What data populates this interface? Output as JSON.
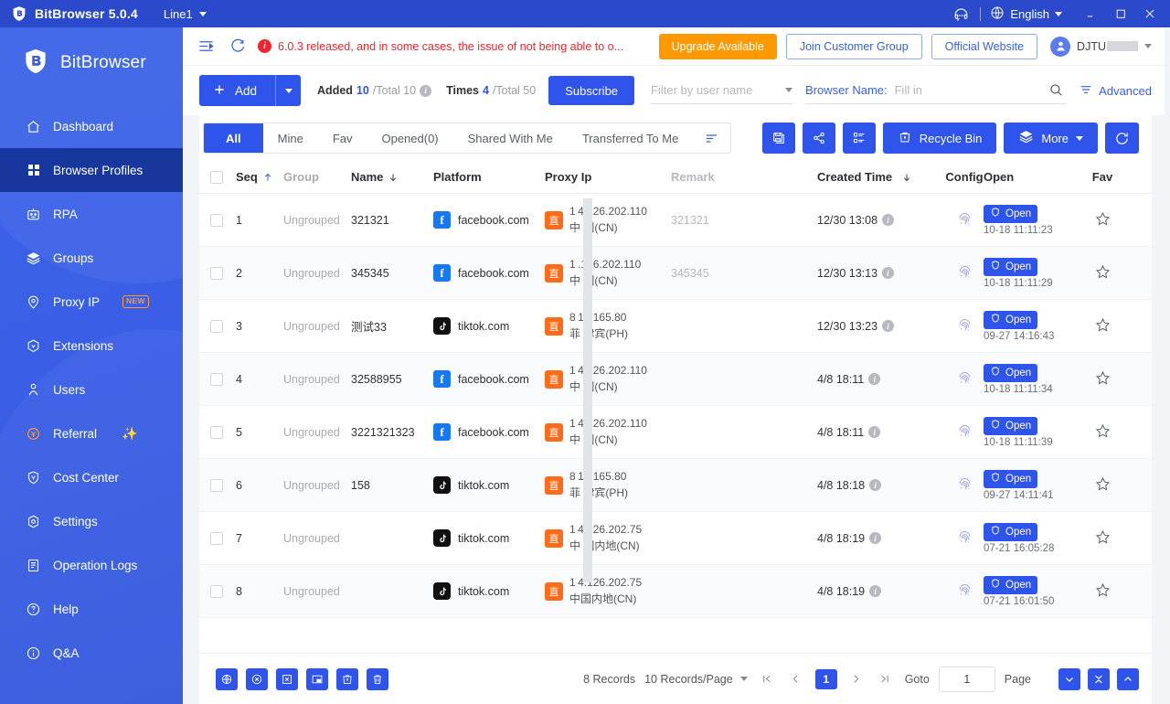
{
  "titlebar": {
    "app_name": "BitBrowser 5.0.4",
    "line_label": "Line1",
    "language": "English",
    "icons": {
      "headset": "headset-icon",
      "globe": "globe-icon",
      "minimize": "minimize-icon",
      "maximize": "maximize-icon",
      "close": "close-icon"
    }
  },
  "topbar": {
    "notice": "6.0.3 released, and in some cases, the issue of not being able to o...",
    "upgrade_label": "Upgrade Available",
    "join_group_label": "Join Customer Group",
    "official_site_label": "Official Website",
    "user_name": "DJTU"
  },
  "actionbar": {
    "add_label": "Add",
    "added_label": "Added",
    "added_value": "10",
    "added_total": "/Total 10",
    "times_label": "Times",
    "times_value": "4",
    "times_total": "/Total 50",
    "subscribe_label": "Subscribe",
    "user_filter_placeholder": "Filter by user name",
    "browser_name_label": "Browser Name:",
    "browser_name_placeholder": "Fill in",
    "advanced_label": "Advanced"
  },
  "tabs": [
    {
      "label": "All",
      "active": true
    },
    {
      "label": "Mine",
      "active": false
    },
    {
      "label": "Fav",
      "active": false
    },
    {
      "label": "Opened(0)",
      "active": false
    },
    {
      "label": "Shared With Me",
      "active": false
    },
    {
      "label": "Transferred To Me",
      "active": false
    }
  ],
  "tools": {
    "recycle_bin_label": "Recycle Bin",
    "more_label": "More",
    "icons": [
      "save-icon",
      "share-icon",
      "list-settings-icon",
      "recycle-bin-icon",
      "layers-icon",
      "refresh-icon"
    ]
  },
  "table": {
    "columns": [
      "Seq",
      "Group",
      "Name",
      "Platform",
      "Proxy Ip",
      "Remark",
      "Created Time",
      "Config",
      "Open",
      "Fav"
    ],
    "rows": [
      {
        "seq": "1",
        "group": "Ungrouped",
        "name": "321321",
        "platform": "facebook.com",
        "platform_icon": "facebook-icon",
        "proxy_ip": "1 4.126.202.110",
        "proxy_loc": "中 国(CN)",
        "remark": "321321",
        "created": "12/30 13:08",
        "open_label": "Open",
        "open_time": "10-18 11:11:23"
      },
      {
        "seq": "2",
        "group": "Ungrouped",
        "name": "345345",
        "platform": "facebook.com",
        "platform_icon": "facebook-icon",
        "proxy_ip": "1 .126.202.110",
        "proxy_loc": "中 国(CN)",
        "remark": "345345",
        "created": "12/30 13:13",
        "open_label": "Open",
        "open_time": "10-18 11:11:29"
      },
      {
        "seq": "3",
        "group": "Ungrouped",
        "name": "测试33",
        "platform": "tiktok.com",
        "platform_icon": "tiktok-icon",
        "proxy_ip": "8 12.165.80",
        "proxy_loc": "菲 律宾(PH)",
        "remark": "",
        "created": "12/30 13:23",
        "open_label": "Open",
        "open_time": "09-27 14:16:43"
      },
      {
        "seq": "4",
        "group": "Ungrouped",
        "name": "32588955",
        "platform": "facebook.com",
        "platform_icon": "facebook-icon",
        "proxy_ip": "1 4.126.202.110",
        "proxy_loc": "中 国(CN)",
        "remark": "",
        "created": "4/8 18:11",
        "open_label": "Open",
        "open_time": "10-18 11:11:34"
      },
      {
        "seq": "5",
        "group": "Ungrouped",
        "name": "3221321323",
        "platform": "facebook.com",
        "platform_icon": "facebook-icon",
        "proxy_ip": "1 4.126.202.110",
        "proxy_loc": "中 国(CN)",
        "remark": "",
        "created": "4/8 18:11",
        "open_label": "Open",
        "open_time": "10-18 11:11:39"
      },
      {
        "seq": "6",
        "group": "Ungrouped",
        "name": "158",
        "platform": "tiktok.com",
        "platform_icon": "tiktok-icon",
        "proxy_ip": "8 12.165.80",
        "proxy_loc": "菲 律宾(PH)",
        "remark": "",
        "created": "4/8 18:18",
        "open_label": "Open",
        "open_time": "09-27 14:11:41"
      },
      {
        "seq": "7",
        "group": "Ungrouped",
        "name": "",
        "platform": "tiktok.com",
        "platform_icon": "tiktok-icon",
        "proxy_ip": "1 4.126.202.75",
        "proxy_loc": "中 国内地(CN)",
        "remark": "",
        "created": "4/8 18:19",
        "open_label": "Open",
        "open_time": "07-21 16:05:28"
      },
      {
        "seq": "8",
        "group": "Ungrouped",
        "name": "",
        "platform": "tiktok.com",
        "platform_icon": "tiktok-icon",
        "proxy_ip": "1 4.126.202.75",
        "proxy_loc": "中国内地(CN)",
        "remark": "",
        "created": "4/8 18:19",
        "open_label": "Open",
        "open_time": "07-21 16:01:50"
      }
    ]
  },
  "footer": {
    "record_count": "8 Records",
    "page_size": "10 Records/Page",
    "goto_label": "Goto",
    "goto_value": "1",
    "page_label": "Page",
    "current_page": "1",
    "tool_icons": [
      "proxy-check-icon",
      "close-circle-icon",
      "close-box-icon",
      "window-icon",
      "clear-cache-icon",
      "delete-icon"
    ],
    "right_icons": [
      "chevron-down-icon",
      "collapse-icon",
      "chevron-up-icon"
    ]
  },
  "sidebar": {
    "brand": "BitBrowser",
    "items": [
      {
        "label": "Dashboard",
        "icon": "home-icon",
        "active": false,
        "badge": ""
      },
      {
        "label": "Browser Profiles",
        "icon": "grid-icon",
        "active": true,
        "badge": ""
      },
      {
        "label": "RPA",
        "icon": "robot-icon",
        "active": false,
        "badge": ""
      },
      {
        "label": "Groups",
        "icon": "layers-icon",
        "active": false,
        "badge": ""
      },
      {
        "label": "Proxy IP",
        "icon": "location-pin-icon",
        "active": false,
        "badge": "NEW"
      },
      {
        "label": "Extensions",
        "icon": "puzzle-icon",
        "active": false,
        "badge": ""
      },
      {
        "label": "Users",
        "icon": "user-icon",
        "active": false,
        "badge": ""
      },
      {
        "label": "Referral",
        "icon": "coin-icon",
        "active": false,
        "badge": "sparkle"
      },
      {
        "label": "Cost Center",
        "icon": "shield-icon",
        "active": false,
        "badge": ""
      },
      {
        "label": "Settings",
        "icon": "gear-icon",
        "active": false,
        "badge": ""
      },
      {
        "label": "Operation Logs",
        "icon": "log-icon",
        "active": false,
        "badge": ""
      },
      {
        "label": "Help",
        "icon": "question-icon",
        "active": false,
        "badge": ""
      },
      {
        "label": "Q&A",
        "icon": "info-icon",
        "active": false,
        "badge": ""
      }
    ]
  },
  "colors": {
    "brand_blue": "#2f54eb",
    "title_blue": "#2b4acb",
    "sidebar_blue": "#3a5fe6",
    "sidebar_active": "#17379e",
    "orange": "#ff9900",
    "notice_red": "#f5222d"
  }
}
